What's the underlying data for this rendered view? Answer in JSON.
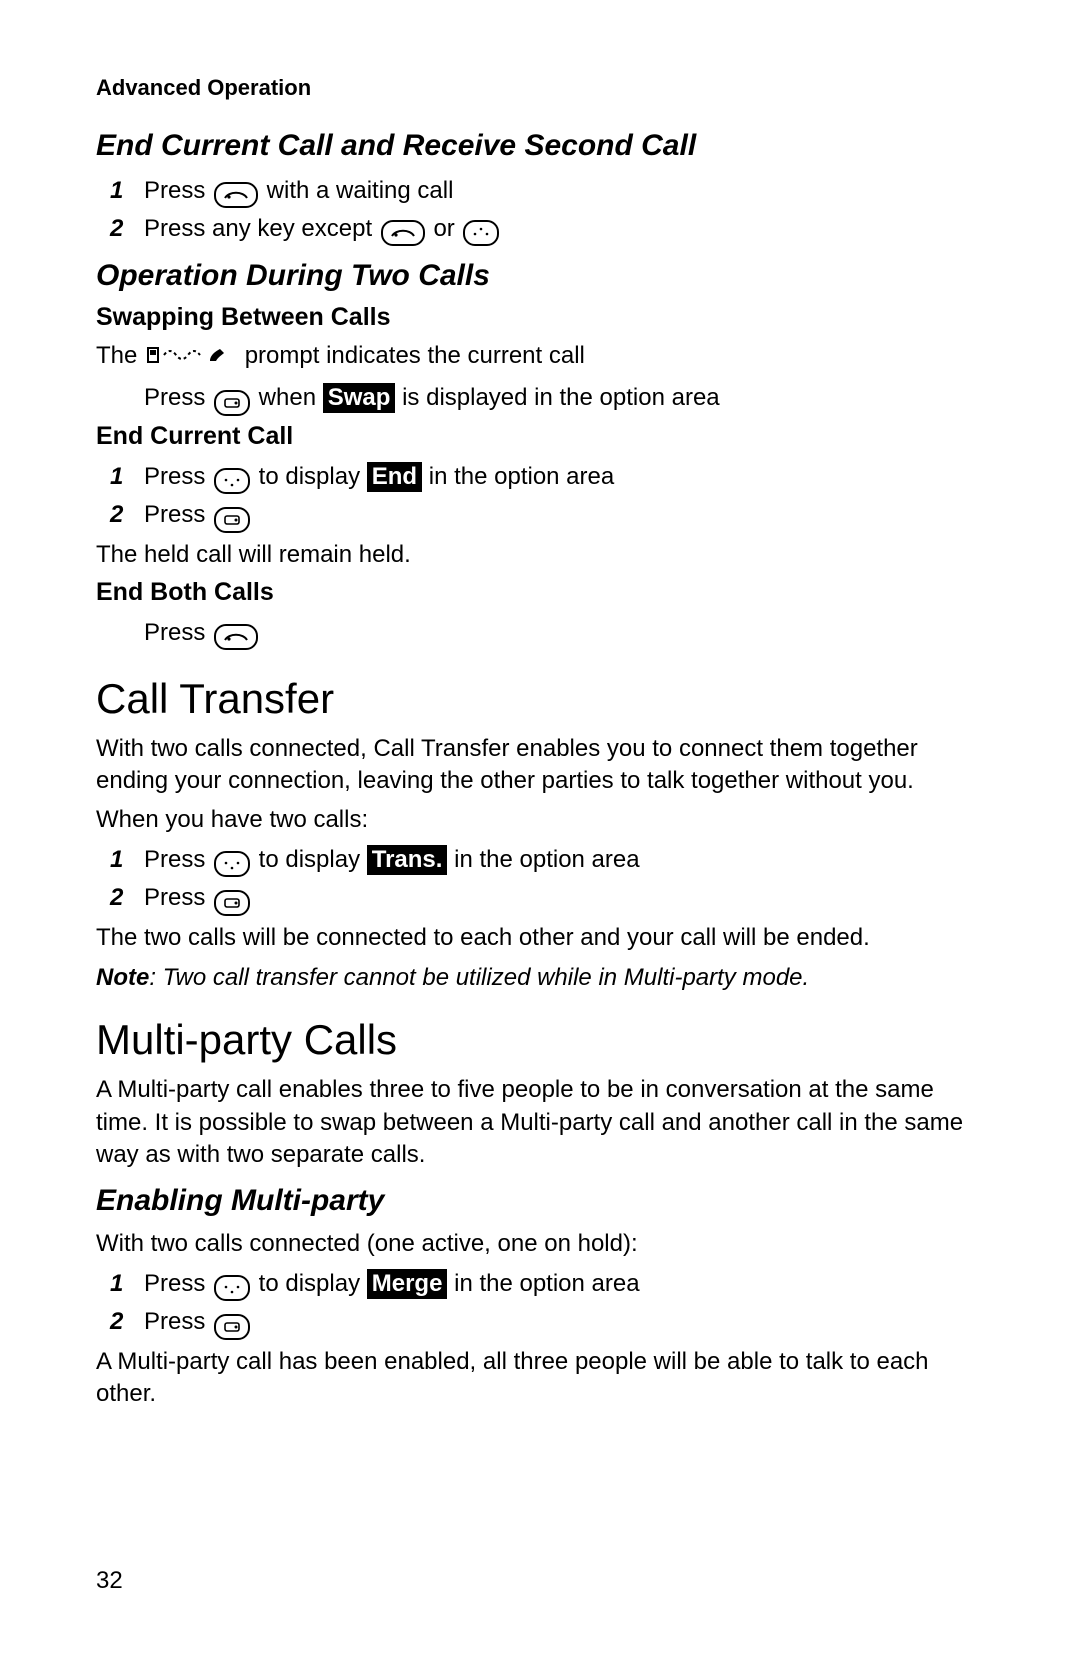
{
  "running_head": "Advanced Operation",
  "sec1": {
    "title": "End Current Call and Receive Second Call",
    "step1_a": "Press ",
    "step1_b": " with a waiting call",
    "step2_a": "Press any key except ",
    "step2_b": " or "
  },
  "sec2": {
    "title": "Operation During Two Calls",
    "swap": {
      "title": "Swapping Between Calls",
      "line1_a": "The ",
      "line1_b": " prompt indicates the current call",
      "line2_a": "Press ",
      "line2_b": " when ",
      "line2_inv": "Swap",
      "line2_c": " is displayed in the option area"
    },
    "endcur": {
      "title": "End Current Call",
      "s1_a": "Press ",
      "s1_b": " to display ",
      "s1_inv": "End",
      "s1_c": " in the option area",
      "s2": "Press ",
      "after": "The held call will remain held."
    },
    "endboth": {
      "title": "End Both Calls",
      "line": "Press "
    }
  },
  "transfer": {
    "title": "Call Transfer",
    "p1": "With two calls connected, Call Transfer enables you to connect them together ending your connection, leaving the other parties to talk together without you.",
    "p2": "When you have two calls:",
    "s1_a": "Press ",
    "s1_b": " to display ",
    "s1_inv": "Trans.",
    "s1_c": " in the option area",
    "s2": "Press ",
    "p3": "The two calls will be connected to each other and your call will be ended.",
    "note_lbl": "Note",
    "note_txt": ": Two call transfer cannot be utilized while in Multi-party mode."
  },
  "multi": {
    "title": "Multi-party Calls",
    "p1": "A Multi-party call enables three to five people to be in conversation at the same time. It is possible to swap between a Multi-party call and another call in the same way as with two separate calls.",
    "enable": {
      "title": "Enabling Multi-party",
      "p1": "With two calls connected (one active, one on hold):",
      "s1_a": "Press ",
      "s1_b": " to display ",
      "s1_inv": "Merge",
      "s1_c": " in the option area",
      "s2": "Press ",
      "p2": "A Multi-party call has been enabled, all three people will be able to talk to each other."
    }
  },
  "page_number": "32",
  "nums": {
    "n1": "1",
    "n2": "2"
  }
}
